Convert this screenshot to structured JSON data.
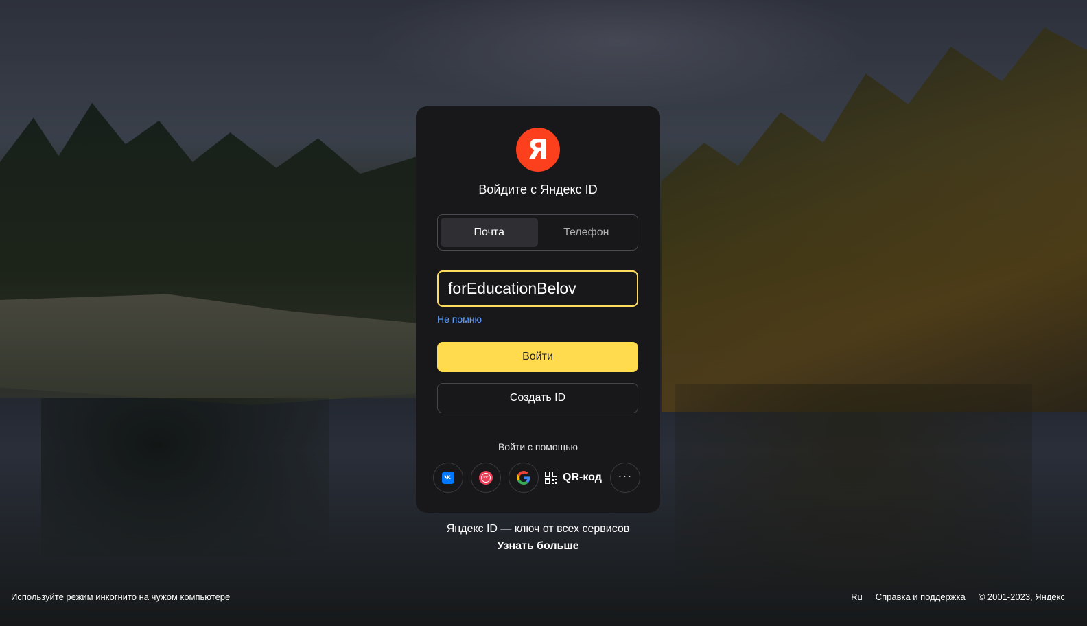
{
  "card": {
    "logo_letter": "Я",
    "title": "Войдите с Яндекс ID",
    "tabs": [
      {
        "label": "Почта",
        "active": true
      },
      {
        "label": "Телефон",
        "active": false
      }
    ],
    "login_value": "forEducationBelov",
    "forgot_label": "Не помню",
    "login_button": "Войти",
    "create_button": "Создать ID",
    "alt_label": "Войти с помощью",
    "social": {
      "vk_icon": "vk-icon",
      "gosuslugi_icon": "gosuslugi-icon",
      "gosuslugi_text": "гос",
      "google_icon": "google-icon",
      "qr_label": "QR-код",
      "more_icon": "more-icon"
    }
  },
  "promo": {
    "tagline": "Яндекс ID — ключ от всех сервисов",
    "learn_more": "Узнать больше"
  },
  "footer": {
    "incognito_hint": "Используйте режим инкогнито на чужом компьютере",
    "language": "Ru",
    "support": "Справка и поддержка",
    "copyright": "© 2001-2023, Яндекс"
  },
  "colors": {
    "accent_yellow": "#ffdb4d",
    "brand_red": "#fc3f1d",
    "link_blue": "#5fa0ff",
    "card_bg": "#18181b"
  }
}
